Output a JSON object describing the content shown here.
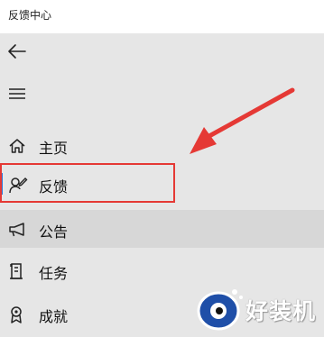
{
  "window": {
    "title": "反馈中心"
  },
  "header": {
    "back_icon": "back-arrow-icon",
    "menu_icon": "hamburger-menu-icon"
  },
  "nav": {
    "items": [
      {
        "label": "主页",
        "icon": "home-icon",
        "selected": false
      },
      {
        "label": "反馈",
        "icon": "feedback-icon",
        "selected": true
      },
      {
        "label": "公告",
        "icon": "megaphone-icon",
        "selected": false
      },
      {
        "label": "任务",
        "icon": "quest-icon",
        "selected": false
      },
      {
        "label": "成就",
        "icon": "achievement-icon",
        "selected": false
      }
    ]
  },
  "annotation": {
    "color": "#e53935"
  },
  "accent_color": "#2b79d9",
  "watermark": {
    "text": "好装机"
  }
}
